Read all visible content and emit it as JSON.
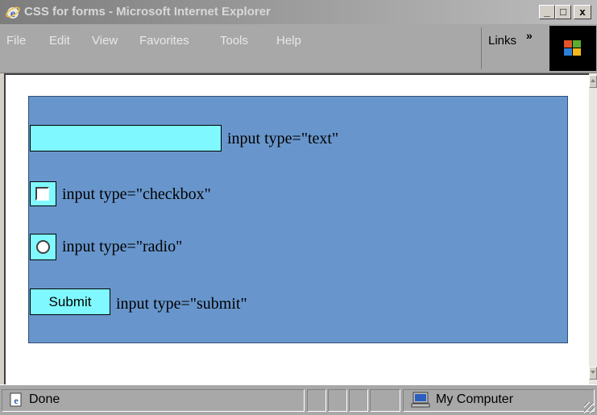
{
  "window": {
    "title": "CSS for forms - Microsoft Internet Explorer",
    "minimize_label": "_",
    "maximize_label": "□",
    "close_label": "x"
  },
  "menu": {
    "items": [
      "File",
      "Edit",
      "View",
      "Favorites",
      "Tools",
      "Help"
    ],
    "links_label": "Links",
    "links_chevron": "»"
  },
  "form": {
    "panel_color": "#6896cc",
    "field_color": "#7ff9ff",
    "text_field": {
      "value": "",
      "label": "input type=\"text\""
    },
    "checkbox": {
      "checked": false,
      "label": "input type=\"checkbox\""
    },
    "radio": {
      "checked": false,
      "label": "input type=\"radio\""
    },
    "submit": {
      "value": "Submit",
      "label": "input type=\"submit\""
    }
  },
  "status": {
    "text": "Done",
    "zone": "My Computer"
  },
  "icons": {
    "ie": "ie-logo-icon",
    "windows": "windows-logo-icon",
    "status_page": "page-done-icon",
    "zone": "my-computer-icon"
  }
}
